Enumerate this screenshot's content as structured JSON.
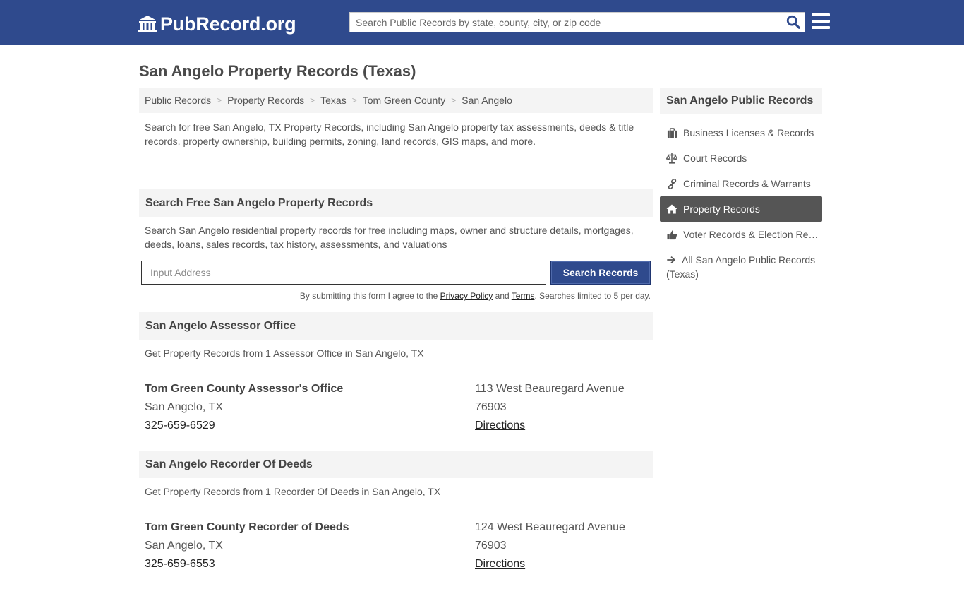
{
  "header": {
    "logo_text": "PubRecord.org",
    "search_placeholder": "Search Public Records by state, county, city, or zip code",
    "brand_color": "#2f4a8d"
  },
  "page": {
    "title": "San Angelo Property Records (Texas)"
  },
  "breadcrumb": [
    "Public Records",
    "Property Records",
    "Texas",
    "Tom Green County",
    "San Angelo"
  ],
  "intro": "Search for free San Angelo, TX Property Records, including San Angelo property tax assessments, deeds & title records, property ownership, building permits, zoning, land records, GIS maps, and more.",
  "search_section": {
    "heading": "Search Free San Angelo Property Records",
    "description": "Search San Angelo residential property records for free including maps, owner and structure details, mortgages, deeds, loans, sales records, tax history, assessments, and valuations",
    "input_placeholder": "Input Address",
    "button_label": "Search Records",
    "disclaimer_pre": "By submitting this form I agree to the ",
    "privacy_label": "Privacy Policy",
    "disclaimer_and": " and ",
    "terms_label": "Terms",
    "disclaimer_post": ". Searches limited to 5 per day."
  },
  "assessor": {
    "heading": "San Angelo Assessor Office",
    "description": "Get Property Records from 1 Assessor Office in San Angelo, TX",
    "office": {
      "name": "Tom Green County Assessor's Office",
      "city": "San Angelo, TX",
      "phone": "325-659-6529",
      "address": "113 West Beauregard Avenue",
      "zip": "76903",
      "directions_label": "Directions"
    }
  },
  "recorder": {
    "heading": "San Angelo Recorder Of Deeds",
    "description": "Get Property Records from 1 Recorder Of Deeds in San Angelo, TX",
    "office": {
      "name": "Tom Green County Recorder of Deeds",
      "city": "San Angelo, TX",
      "phone": "325-659-6553",
      "address": "124 West Beauregard Avenue",
      "zip": "76903",
      "directions_label": "Directions"
    }
  },
  "sidebar": {
    "heading": "San Angelo Public Records",
    "items": [
      {
        "label": "Business Licenses & Records",
        "icon": "briefcase-icon"
      },
      {
        "label": "Court Records",
        "icon": "scale-icon"
      },
      {
        "label": "Criminal Records & Warrants",
        "icon": "link-icon"
      },
      {
        "label": "Property Records",
        "icon": "home-icon",
        "active": true
      },
      {
        "label": "Voter Records & Election Records",
        "icon": "thumbs-up-icon"
      },
      {
        "label": "All San Angelo Public Records (Texas)",
        "icon": "arrow-right-icon"
      }
    ]
  }
}
